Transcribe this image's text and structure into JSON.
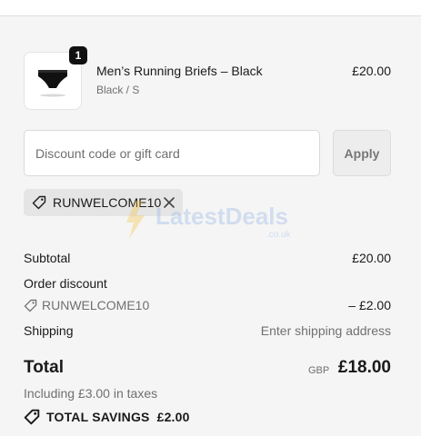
{
  "line_item": {
    "quantity": "1",
    "name": "Men’s Running Briefs – Black",
    "variant": "Black / S",
    "price": "£20.00"
  },
  "discount": {
    "placeholder": "Discount code or gift card",
    "apply_label": "Apply",
    "applied_code": "RUNWELCOME10"
  },
  "watermark": {
    "brand": "LatestDeals",
    "suffix": ".co.uk"
  },
  "summary": {
    "subtotal_label": "Subtotal",
    "subtotal_value": "£20.00",
    "order_discount_label": "Order discount",
    "discount_code": "RUNWELCOME10",
    "discount_value": "– £2.00",
    "shipping_label": "Shipping",
    "shipping_value": "Enter shipping address",
    "total_label": "Total",
    "currency": "GBP",
    "total_value": "£18.00",
    "taxes_note": "Including £3.00 in taxes",
    "savings_label": "TOTAL SAVINGS",
    "savings_value": "£2.00"
  },
  "colors": {
    "panel_bg": "#f5f5f5",
    "chip_bg": "#e5e5e5",
    "badge_bg": "#111111",
    "watermark": "#f6c342"
  }
}
